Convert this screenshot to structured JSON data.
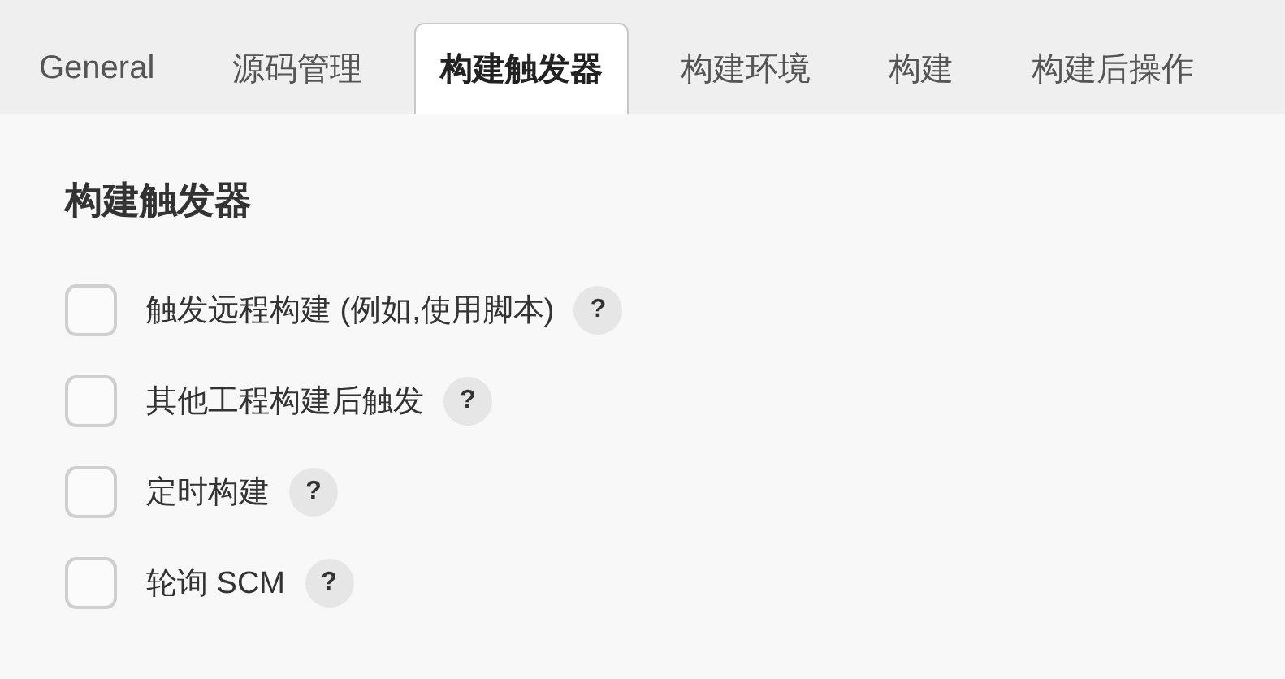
{
  "tabs": [
    {
      "label": "General",
      "selected": false
    },
    {
      "label": "源码管理",
      "selected": false
    },
    {
      "label": "构建触发器",
      "selected": true
    },
    {
      "label": "构建环境",
      "selected": false
    },
    {
      "label": "构建",
      "selected": false
    },
    {
      "label": "构建后操作",
      "selected": false
    }
  ],
  "section": {
    "title": "构建触发器",
    "options": [
      {
        "label": "触发远程构建 (例如,使用脚本)",
        "checked": false,
        "help": "?"
      },
      {
        "label": "其他工程构建后触发",
        "checked": false,
        "help": "?"
      },
      {
        "label": "定时构建",
        "checked": false,
        "help": "?"
      },
      {
        "label": "轮询 SCM",
        "checked": false,
        "help": "?"
      }
    ]
  }
}
